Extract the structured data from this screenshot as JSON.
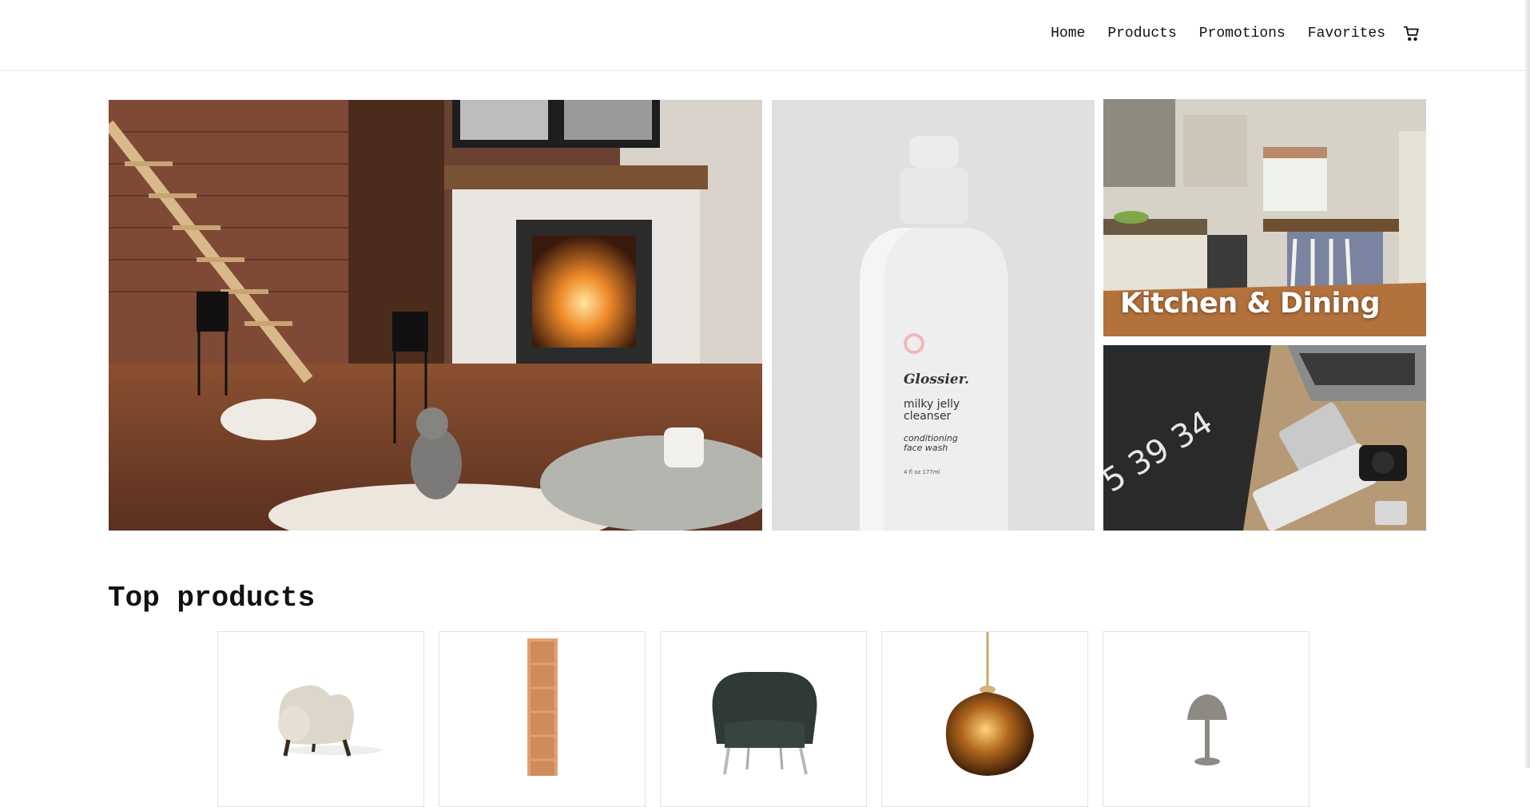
{
  "nav": {
    "items": [
      "Home",
      "Products",
      "Promotions",
      "Favorites"
    ],
    "cart_icon": "cart-icon"
  },
  "hero": {
    "tiles": [
      {
        "name": "living-room-fireplace",
        "caption": ""
      },
      {
        "name": "skincare-bottle",
        "caption": "",
        "brand_text": "Glossier.",
        "product_line1": "milky jelly",
        "product_line2": "cleanser",
        "product_sub1": "conditioning",
        "product_sub2": "face wash",
        "volume": "4 fl oz  177ml"
      },
      {
        "name": "kitchen",
        "caption": "Kitchen & Dining"
      },
      {
        "name": "electronics-desk",
        "caption": "",
        "desk_text": "5 39 34"
      }
    ]
  },
  "top_products": {
    "title": "Top products",
    "items": [
      {
        "name": "fluffy-armchair"
      },
      {
        "name": "tall-bookshelf"
      },
      {
        "name": "green-armchair"
      },
      {
        "name": "amber-pendant-lamp"
      },
      {
        "name": "mushroom-table-lamp"
      }
    ]
  },
  "colors": {
    "text": "#111111",
    "border": "#e3e3e3",
    "caption": "#ffffff"
  }
}
